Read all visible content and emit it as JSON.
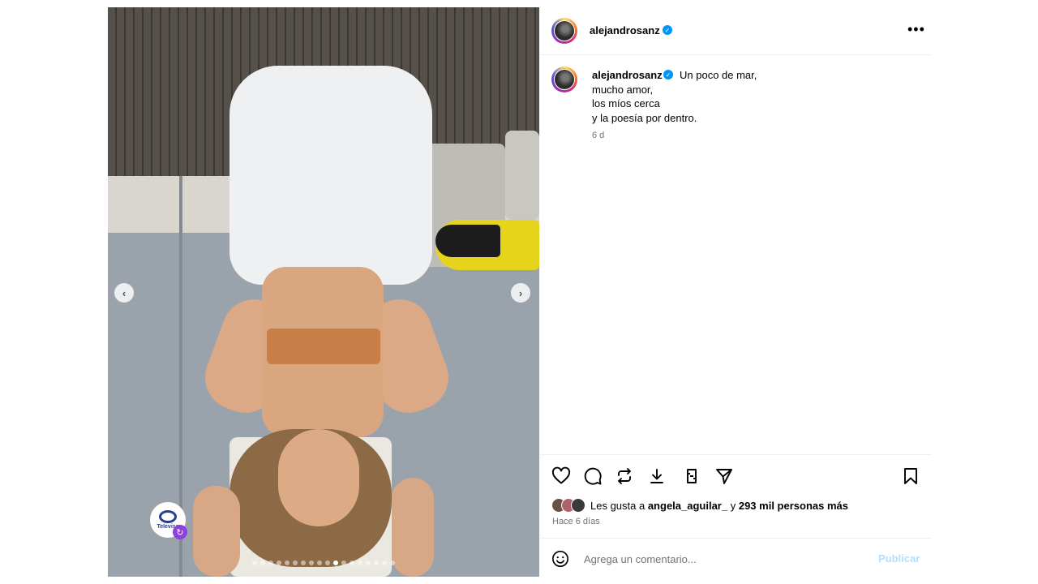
{
  "post": {
    "username": "alejandrosanz",
    "verified": true,
    "more_icon": "more-horizontal-icon"
  },
  "caption": {
    "username": "alejandrosanz",
    "lines": [
      "Un poco de mar,",
      "mucho amor,",
      "los míos cerca",
      "y la poesía por dentro."
    ],
    "time": "6 d"
  },
  "media": {
    "carousel_total": 18,
    "carousel_active_index": 10,
    "watermark": "Televisa",
    "prev_icon": "chevron-left-icon",
    "next_icon": "chevron-right-icon"
  },
  "actions": {
    "icons": [
      "heart-icon",
      "comment-icon",
      "repost-icon",
      "download-icon",
      "share-icon",
      "send-icon",
      "bookmark-icon"
    ]
  },
  "likes": {
    "prefix": "Les gusta a ",
    "user": "angela_aguilar_",
    "middle": " y ",
    "others": "293 mil personas más"
  },
  "post_date": "Hace 6 días",
  "comment": {
    "placeholder": "Agrega un comentario...",
    "publish_label": "Publicar"
  },
  "colors": {
    "verified": "#0095f6",
    "publish_disabled": "#b2dffc",
    "muted_text": "#737373"
  }
}
